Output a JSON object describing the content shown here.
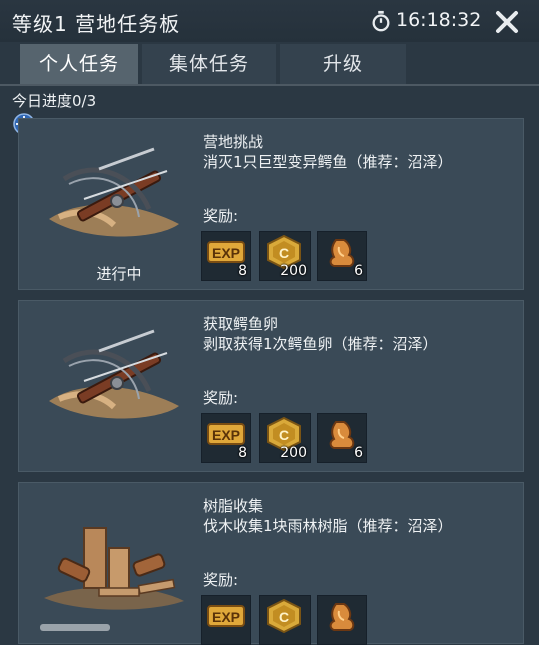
{
  "header": {
    "title": "等级1 营地任务板",
    "timer": "16:18:32"
  },
  "tabs": [
    {
      "label": "个人任务",
      "active": true
    },
    {
      "label": "集体任务",
      "active": false
    },
    {
      "label": "升级",
      "active": false
    }
  ],
  "progress_text": "今日进度0/3",
  "tasks": [
    {
      "title": "营地挑战",
      "desc": "消灭1只巨型变异鳄鱼（推荐：沼泽）",
      "status": "进行中",
      "reward_label": "奖励:",
      "rewards": [
        {
          "icon": "exp-icon",
          "count": "8"
        },
        {
          "icon": "coin-icon",
          "count": "200"
        },
        {
          "icon": "resource-icon",
          "count": "6"
        }
      ]
    },
    {
      "title": "获取鳄鱼卵",
      "desc": "剥取获得1次鳄鱼卵（推荐：沼泽）",
      "status": "",
      "reward_label": "奖励:",
      "rewards": [
        {
          "icon": "exp-icon",
          "count": "8"
        },
        {
          "icon": "coin-icon",
          "count": "200"
        },
        {
          "icon": "resource-icon",
          "count": "6"
        }
      ]
    },
    {
      "title": "树脂收集",
      "desc": "伐木收集1块雨林树脂（推荐：沼泽）",
      "status": "",
      "reward_label": "奖励:",
      "rewards": [
        {
          "icon": "exp-icon",
          "count": ""
        },
        {
          "icon": "coin-icon",
          "count": ""
        },
        {
          "icon": "resource-icon",
          "count": ""
        }
      ]
    }
  ],
  "colors": {
    "background": "#2b3843",
    "card": "#3a4a57",
    "tab_active": "#56646e",
    "tab_inactive": "#34424e",
    "gold": "#d9a93a"
  }
}
